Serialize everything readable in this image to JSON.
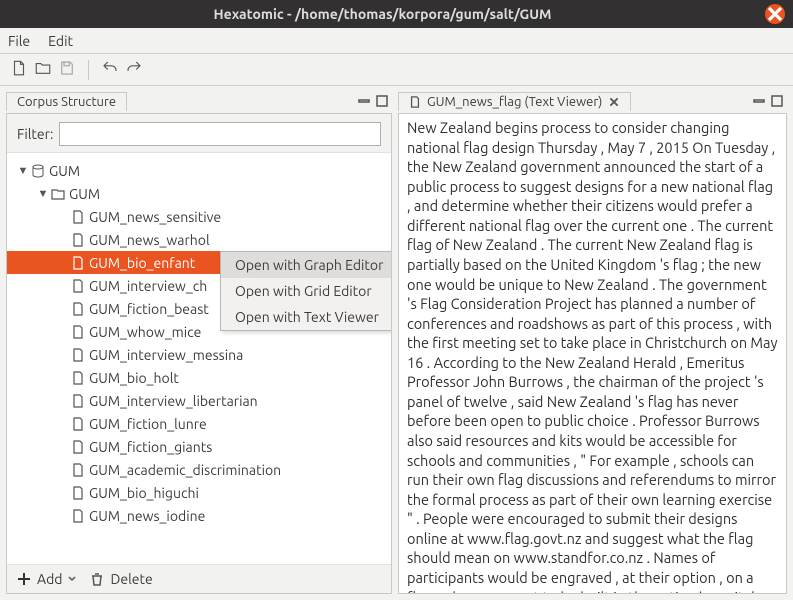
{
  "window": {
    "title": "Hexatomic - /home/thomas/korpora/gum/salt/GUM"
  },
  "menubar": {
    "file": "File",
    "edit": "Edit"
  },
  "left": {
    "tab_label": "Corpus Structure",
    "filter_label": "Filter:",
    "filter_value": "",
    "add": "Add",
    "delete": "Delete"
  },
  "tree": {
    "l0": "GUM",
    "l1": "GUM",
    "items": [
      "GUM_news_sensitive",
      "GUM_news_warhol",
      "GUM_bio_enfant",
      "GUM_interview_ch",
      "GUM_fiction_beast",
      "GUM_whow_mice",
      "GUM_interview_messina",
      "GUM_bio_holt",
      "GUM_interview_libertarian",
      "GUM_fiction_lunre",
      "GUM_fiction_giants",
      "GUM_academic_discrimination",
      "GUM_bio_higuchi",
      "GUM_news_iodine"
    ],
    "selected_index": 2
  },
  "context_menu": {
    "items": [
      "Open with Graph Editor",
      "Open with Grid Editor",
      "Open with Text Viewer"
    ],
    "hover_index": 0
  },
  "right": {
    "tab_label": "GUM_news_flag (Text Viewer)",
    "text": "New Zealand begins process to consider changing national flag design Thursday , May 7 , 2015 On Tuesday , the New Zealand government announced the start of a public process to suggest designs for a new national flag , and determine whether their citizens would prefer a different national flag over the current one . The current flag of New Zealand . The current New Zealand flag is partially based on the United Kingdom 's flag ; the new one would be unique to New Zealand . The government 's Flag Consideration Project has planned a number of conferences and roadshows as part of this process , with the first meeting set to take place in Christchurch on May 16 . According to the New Zealand Herald , Emeritus Professor John Burrows , the chairman of the project 's panel of twelve , said New Zealand 's flag has never before been open to public choice . Professor Burrows also said resources and kits would be accessible for schools and communities , \" For example , schools can run their own flag discussions and referendums to mirror the formal process as part of their own learning exercise \" . People were encouraged to submit their designs online at www.flag.govt.nz and suggest what the flag should mean on www.standfor.co.nz . Names of participants would be engraved , at their option , on a flag pole monument to be built in the nation 's capital , Wellington . New Zealand 's Prime Minister John Key said he believes redesigning the flag now has a \" strong rationale \" . Mr Key promoted the"
  }
}
